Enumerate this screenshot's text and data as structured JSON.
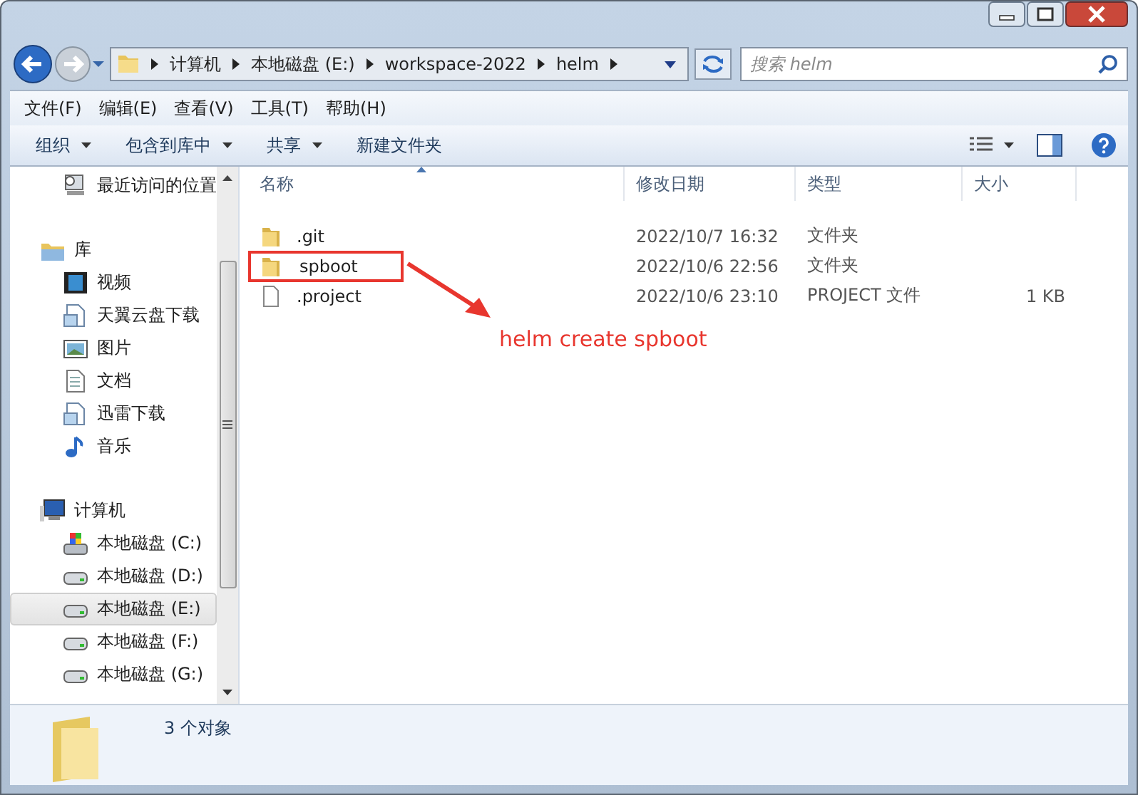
{
  "address_bar": {
    "segments": [
      "计算机",
      "本地磁盘 (E:)",
      "workspace-2022",
      "helm"
    ]
  },
  "search": {
    "placeholder": "搜索 helm"
  },
  "menu_bar": [
    "文件(F)",
    "编辑(E)",
    "查看(V)",
    "工具(T)",
    "帮助(H)"
  ],
  "toolbar": [
    {
      "label": "组织",
      "dropdown": true
    },
    {
      "label": "包含到库中",
      "dropdown": true
    },
    {
      "label": "共享",
      "dropdown": true
    },
    {
      "label": "新建文件夹",
      "dropdown": false
    }
  ],
  "sidebar": {
    "items": [
      {
        "label": "最近访问的位置",
        "kind": "recent",
        "selected": false
      },
      {
        "label": "库",
        "kind": "library",
        "selected": false,
        "children": [
          {
            "label": "视频",
            "kind": "video",
            "selected": false
          },
          {
            "label": "天翼云盘下载",
            "kind": "doc",
            "selected": false
          },
          {
            "label": "图片",
            "kind": "picture",
            "selected": false
          },
          {
            "label": "文档",
            "kind": "text",
            "selected": false
          },
          {
            "label": "迅雷下载",
            "kind": "doc",
            "selected": false
          },
          {
            "label": "音乐",
            "kind": "music",
            "selected": false
          }
        ]
      },
      {
        "label": "计算机",
        "kind": "computer",
        "selected": false,
        "children": [
          {
            "label": "本地磁盘 (C:)",
            "kind": "system-drive",
            "selected": false
          },
          {
            "label": "本地磁盘 (D:)",
            "kind": "drive",
            "selected": false
          },
          {
            "label": "本地磁盘 (E:)",
            "kind": "drive",
            "selected": true
          },
          {
            "label": "本地磁盘 (F:)",
            "kind": "drive",
            "selected": false
          },
          {
            "label": "本地磁盘 (G:)",
            "kind": "drive",
            "selected": false
          }
        ]
      }
    ]
  },
  "table": {
    "columns": [
      "名称",
      "修改日期",
      "类型",
      "大小"
    ],
    "rows": [
      {
        "name": ".git",
        "date": "2022/10/7 16:32",
        "type": "文件夹",
        "kind": "folder",
        "highlighted": false
      },
      {
        "name": "spboot",
        "date": "2022/10/6 22:56",
        "type": "文件夹",
        "kind": "folder",
        "highlighted": true
      },
      {
        "name": ".project",
        "date": "2022/10/6 23:10",
        "type": "PROJECT 文件",
        "size": "1 KB",
        "kind": "file",
        "highlighted": false
      }
    ]
  },
  "annotation": {
    "text": "helm create spboot"
  },
  "status_bar": {
    "text": "3 个对象"
  }
}
